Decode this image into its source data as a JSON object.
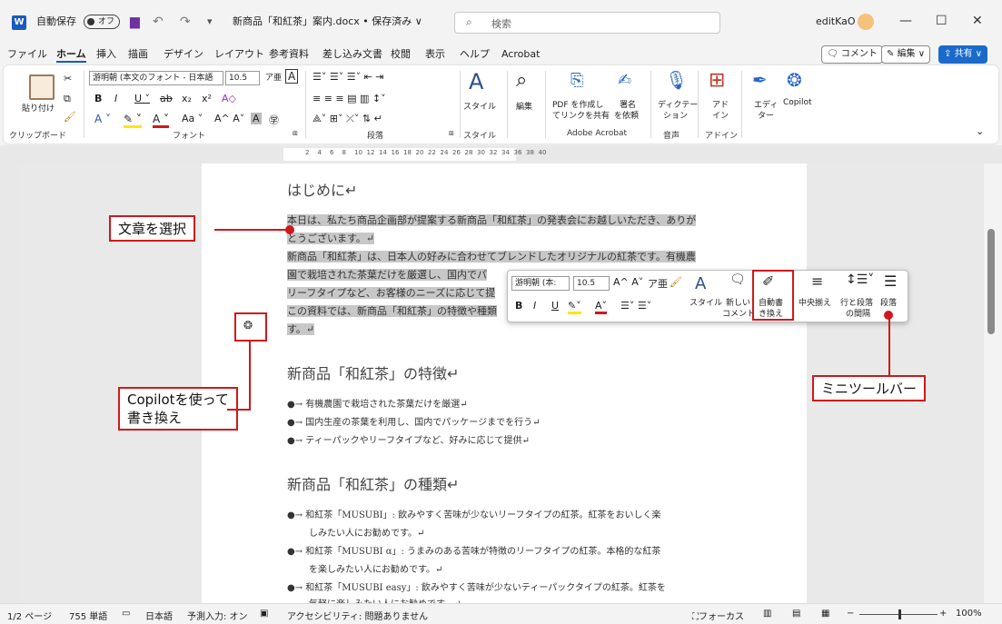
{
  "titlebar": {
    "autosave_label": "自動保存",
    "autosave_state": "オフ",
    "filename": "新商品「和紅茶」案内.docx • 保存済み ∨",
    "search_placeholder": "検索",
    "user": "editKaO"
  },
  "menu": {
    "tabs": [
      "ファイル",
      "ホーム",
      "挿入",
      "描画",
      "デザイン",
      "レイアウト",
      "参考資料",
      "差し込み文書",
      "校閲",
      "表示",
      "ヘルプ",
      "Acrobat"
    ],
    "comment": "コメント",
    "edit": "編集 ∨",
    "share": "共有 ∨"
  },
  "ribbon": {
    "paste": "貼り付け",
    "clipboard": "クリップボード",
    "font_name": "游明朝 (本文のフォント - 日本語",
    "font_size": "10.5",
    "font_group": "フォント",
    "paragraph_group": "段落",
    "style_label": "スタイル",
    "style_group": "スタイル",
    "editing": "編集",
    "pdf_create": "PDF を作成し",
    "pdf_share": "てリンクを共有",
    "sign": "署名",
    "sign_request": "を依頼",
    "acrobat_group": "Adobe Acrobat",
    "dictate": "ディクテー",
    "dictate2": "ション",
    "voice_group": "音声",
    "addin": "アド",
    "addin2": "イン",
    "addin_group": "アドイン",
    "editor": "エディ",
    "editor2": "ター",
    "copilot": "Copilot"
  },
  "ruler": {
    "ticks": [
      "2",
      "4",
      "6",
      "8",
      "10",
      "12",
      "14",
      "16",
      "18",
      "20",
      "22",
      "24",
      "26",
      "28",
      "30",
      "32",
      "34",
      "36",
      "38",
      "40"
    ]
  },
  "document": {
    "h1": "はじめに↵",
    "p1": "本日は、私たち商品企画部が提案する新商品「和紅茶」の発表会にお越しいただき、ありが",
    "p2": "とうございます。↵",
    "p3": "新商品「和紅茶」は、日本人の好みに合わせてブレンドしたオリジナルの紅茶です。有機農",
    "p4": "園で栽培された茶葉だけを厳選し、国内でパ",
    "p5": "リーフタイプなど、お客様のニーズに応じて提",
    "p6": "この資料では、新商品「和紅茶」の特徴や種類",
    "p7": "す。↵",
    "h2": "新商品「和紅茶」の特徴↵",
    "f1": "●→ 有機農園で栽培された茶葉だけを厳選↵",
    "f2": "●→ 国内生産の茶葉を利用し、国内でパッケージまでを行う↵",
    "f3": "●→ ティーパックやリーフタイプなど、好みに応じて提供↵",
    "h3": "新商品「和紅茶」の種類↵",
    "k1": "●→ 和紅茶「MUSUBI」: 飲みやすく苦味が少ないリーフタイプの紅茶。紅茶をおいしく楽",
    "k1b": "しみたい人にお勧めです。↵",
    "k2": "●→ 和紅茶「MUSUBI α」: うまみのある苦味が特徴のリーフタイプの紅茶。本格的な紅茶",
    "k2b": "を楽しみたい人にお勧めです。↵",
    "k3": "●→ 和紅茶「MUSUBI easy」: 飲みやすく苦味が少ないティーパックタイプの紅茶。紅茶を",
    "k3b": "気軽に楽しみたい人にお勧めです。↵"
  },
  "minitoolbar": {
    "font": "游明朝 (本:",
    "size": "10.5",
    "style": "スタイル",
    "new_comment": "新しい",
    "new_comment2": "コメント",
    "auto_rewrite": "自動書",
    "auto_rewrite2": "き換え",
    "center": "中央揃え",
    "line_spacing": "行と段落",
    "line_spacing2": "の間隔",
    "paragraph": "段落"
  },
  "callouts": {
    "select_text": "文章を選択",
    "copilot_line1": "Copilotを使って",
    "copilot_line2": "書き換え",
    "mini_toolbar": "ミニツールバー"
  },
  "status": {
    "page": "1/2 ページ",
    "words": "755 単語",
    "language": "日本語",
    "predict": "予測入力: オン",
    "accessibility": "アクセシビリティ: 問題ありません",
    "focus": "フォーカス",
    "zoom": "100%"
  },
  "colors": {
    "accent": "#185abd",
    "callout": "#d0181c"
  }
}
